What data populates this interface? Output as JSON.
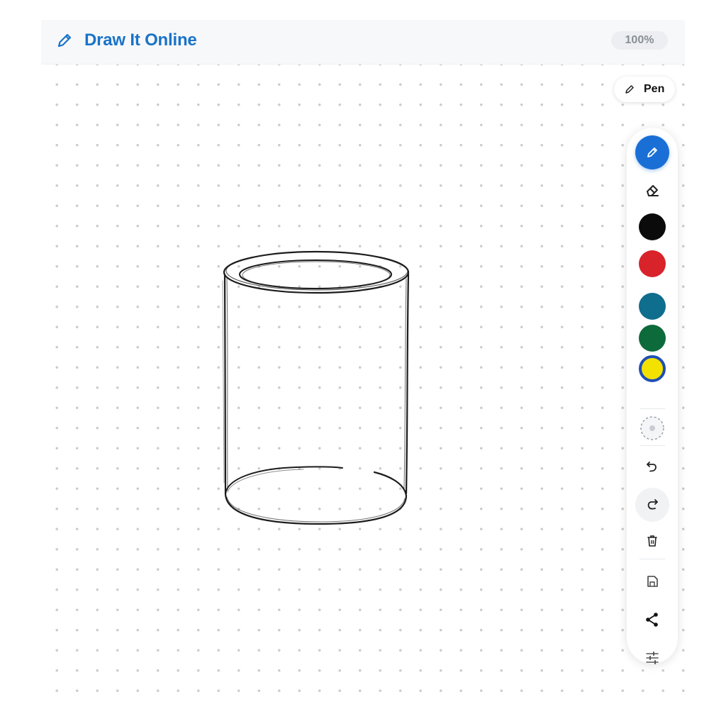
{
  "app": {
    "title": "Draw It Online",
    "zoom": "100%"
  },
  "tool": {
    "current_label": "Pen"
  },
  "toolbar": {
    "tools": [
      {
        "name": "pen",
        "icon": "pencil-icon",
        "active": true
      },
      {
        "name": "eraser",
        "icon": "eraser-icon",
        "active": false
      }
    ],
    "colors": [
      {
        "name": "black",
        "hex": "#0b0b0b",
        "selected": false
      },
      {
        "name": "red",
        "hex": "#d9232a",
        "selected": false
      },
      {
        "name": "teal",
        "hex": "#0f6d8e",
        "selected": false
      },
      {
        "name": "green",
        "hex": "#0d6a3a",
        "selected": false
      },
      {
        "name": "yellow",
        "hex": "#f3e100",
        "selected": true
      }
    ],
    "actions": [
      {
        "name": "brush-size",
        "icon": "brush-size-icon"
      },
      {
        "name": "undo",
        "icon": "undo-icon"
      },
      {
        "name": "redo",
        "icon": "redo-icon"
      },
      {
        "name": "clear",
        "icon": "trash-icon"
      },
      {
        "name": "save",
        "icon": "save-icon"
      },
      {
        "name": "share",
        "icon": "share-icon"
      },
      {
        "name": "settings",
        "icon": "sliders-icon"
      }
    ]
  },
  "colors": {
    "accent": "#1a6fd6",
    "brand_text": "#1a73c8",
    "stroke": "#1c1c1c",
    "grid_dot": "#c9ccd2"
  }
}
